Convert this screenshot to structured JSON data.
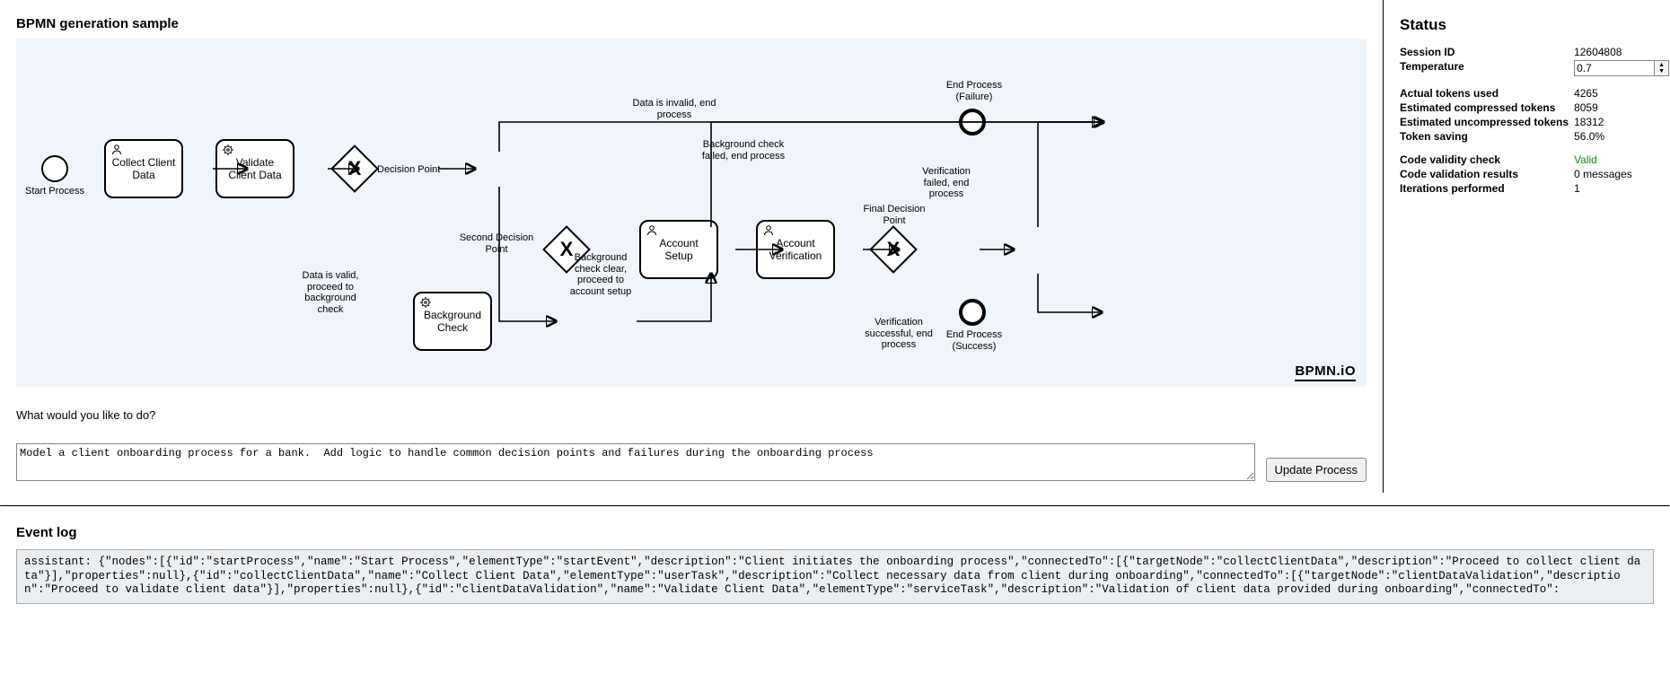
{
  "header": {
    "title": "BPMN generation sample"
  },
  "diagram": {
    "brand": "BPMN.iO",
    "nodes": {
      "start": {
        "label": "Start Process"
      },
      "collect": {
        "label": "Collect Client Data"
      },
      "validate": {
        "label": "Validate Client Data"
      },
      "decision1": {
        "label": "Decision Point"
      },
      "bgcheck": {
        "label": "Background Check"
      },
      "decision2": {
        "label": "Second Decision Point"
      },
      "setup": {
        "label": "Account Setup"
      },
      "verify": {
        "label": "Account Verification"
      },
      "final": {
        "label": "Final Decision Point"
      },
      "endFail": {
        "label": "End Process (Failure)"
      },
      "endSuccess": {
        "label": "End Process (Success)"
      }
    },
    "edgeLabels": {
      "invalid": "Data is invalid, end process",
      "valid": "Data is valid, proceed to background check",
      "bgFail": "Background check failed, end process",
      "bgClear": "Background check clear, proceed to account setup",
      "verFail": "Verification failed, end process",
      "verSuccess": "Verification successful, end process"
    }
  },
  "prompt": {
    "label": "What would you like to do?",
    "value": "Model a client onboarding process for a bank.  Add logic to handle common decision points and failures during the onboarding process",
    "button": "Update Process"
  },
  "status": {
    "heading": "Status",
    "rows": {
      "sessionId": {
        "k": "Session ID",
        "v": "12604808"
      },
      "temperature": {
        "k": "Temperature",
        "v": "0.7"
      },
      "actualTokens": {
        "k": "Actual tokens used",
        "v": "4265"
      },
      "estCompressed": {
        "k": "Estimated compressed tokens",
        "v": "8059"
      },
      "estUncompressed": {
        "k": "Estimated uncompressed tokens",
        "v": "18312"
      },
      "saving": {
        "k": "Token saving",
        "v": "56.0%"
      },
      "validity": {
        "k": "Code validity check",
        "v": "Valid"
      },
      "validation": {
        "k": "Code validation results",
        "v": "0 messages"
      },
      "iterations": {
        "k": "Iterations performed",
        "v": "1"
      }
    }
  },
  "log": {
    "heading": "Event log",
    "body": "assistant: {\"nodes\":[{\"id\":\"startProcess\",\"name\":\"Start Process\",\"elementType\":\"startEvent\",\"description\":\"Client initiates the onboarding process\",\"connectedTo\":[{\"targetNode\":\"collectClientData\",\"description\":\"Proceed to collect client data\"}],\"properties\":null},{\"id\":\"collectClientData\",\"name\":\"Collect Client Data\",\"elementType\":\"userTask\",\"description\":\"Collect necessary data from client during onboarding\",\"connectedTo\":[{\"targetNode\":\"clientDataValidation\",\"description\":\"Proceed to validate client data\"}],\"properties\":null},{\"id\":\"clientDataValidation\",\"name\":\"Validate Client Data\",\"elementType\":\"serviceTask\",\"description\":\"Validation of client data provided during onboarding\",\"connectedTo\":"
  }
}
